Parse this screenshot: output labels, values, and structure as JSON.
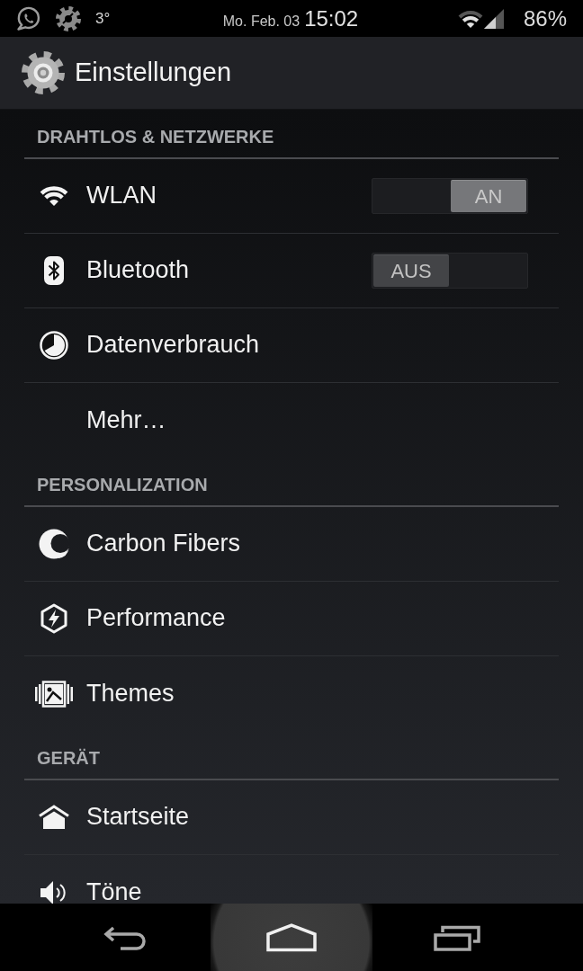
{
  "status_bar": {
    "temperature": "3°",
    "date": "Mo. Feb. 03",
    "time": "15:02",
    "battery": "86%"
  },
  "action_bar": {
    "title": "Einstellungen"
  },
  "sections": [
    {
      "title": "DRAHTLOS & NETZWERKE",
      "items": [
        {
          "kind": "toggle",
          "label": "WLAN",
          "on": true,
          "switch_text": "AN"
        },
        {
          "kind": "toggle",
          "label": "Bluetooth",
          "on": false,
          "switch_text": "AUS"
        },
        {
          "kind": "link",
          "label": "Datenverbrauch"
        },
        {
          "kind": "link",
          "label": "Mehr…"
        }
      ]
    },
    {
      "title": "PERSONALIZATION",
      "items": [
        {
          "kind": "link",
          "label": "Carbon Fibers"
        },
        {
          "kind": "link",
          "label": "Performance"
        },
        {
          "kind": "link",
          "label": "Themes"
        }
      ]
    },
    {
      "title": "GERÄT",
      "items": [
        {
          "kind": "link",
          "label": "Startseite"
        },
        {
          "kind": "link",
          "label": "Töne"
        }
      ]
    }
  ]
}
